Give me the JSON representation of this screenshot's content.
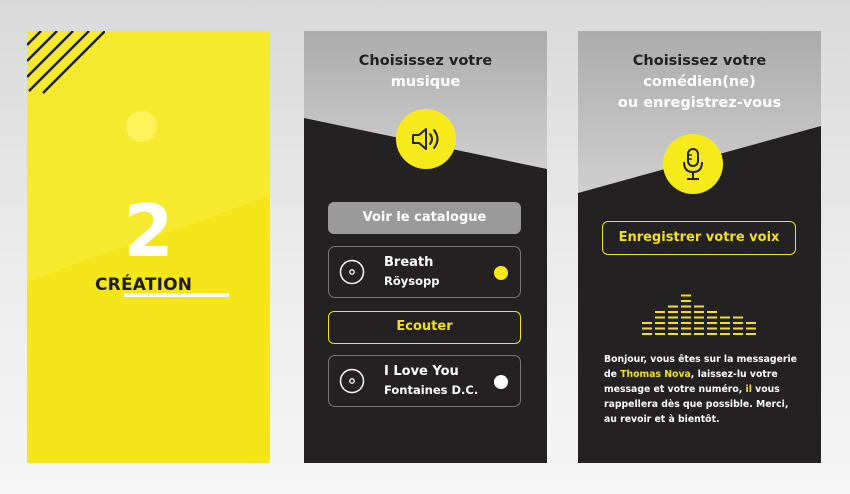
{
  "panel1": {
    "number": "2",
    "label": "CRÉATION"
  },
  "panel2": {
    "title_line1": "Choisissez votre",
    "title_line2": "musique",
    "icon": "speaker-icon",
    "catalog_button": "Voir le catalogue",
    "tracks": [
      {
        "title": "Breath",
        "artist": "Röysopp",
        "selected": true
      },
      {
        "title": "I Love You",
        "artist": "Fontaines D.C.",
        "selected": false
      }
    ],
    "listen_button": "Ecouter"
  },
  "panel3": {
    "title_line1": "Choisissez votre",
    "title_line2": "comédien(ne)",
    "title_line3": "ou enregistrez-vous",
    "icon": "microphone-icon",
    "record_button": "Enregistrer votre voix",
    "message_parts": {
      "p1": "Bonjour, vous êtes sur la messagerie de ",
      "name": "Thomas Nova",
      "p2": ", laissez-lu votre message et votre numéro, ",
      "il": "il",
      "p3": " vous rappellera dès que possible. Merci, au revoir et à bientôt."
    }
  },
  "colors": {
    "yellow": "#f4e61a",
    "dark": "#232122",
    "gray": "#9a9a9a"
  }
}
